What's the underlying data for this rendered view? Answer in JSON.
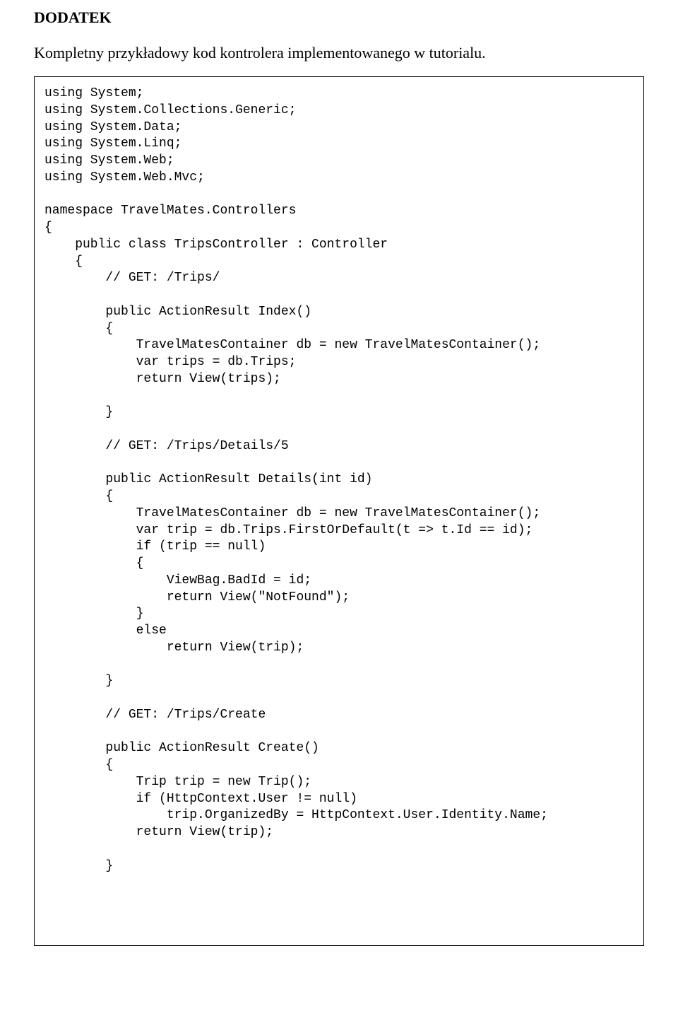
{
  "heading": "DODATEK",
  "intro": "Kompletny przykładowy kod kontrolera implementowanego w tutorialu.",
  "code": "using System;\nusing System.Collections.Generic;\nusing System.Data;\nusing System.Linq;\nusing System.Web;\nusing System.Web.Mvc;\n\nnamespace TravelMates.Controllers\n{\n    public class TripsController : Controller\n    {\n        // GET: /Trips/\n\n        public ActionResult Index()\n        {\n            TravelMatesContainer db = new TravelMatesContainer();\n            var trips = db.Trips;\n            return View(trips);\n\n        }\n\n        // GET: /Trips/Details/5\n\n        public ActionResult Details(int id)\n        {\n            TravelMatesContainer db = new TravelMatesContainer();\n            var trip = db.Trips.FirstOrDefault(t => t.Id == id);\n            if (trip == null)\n            {\n                ViewBag.BadId = id;\n                return View(\"NotFound\");\n            }\n            else\n                return View(trip);\n\n        }\n\n        // GET: /Trips/Create\n\n        public ActionResult Create()\n        {\n            Trip trip = new Trip();\n            if (HttpContext.User != null)\n                trip.OrganizedBy = HttpContext.User.Identity.Name;\n            return View(trip);\n\n        }"
}
